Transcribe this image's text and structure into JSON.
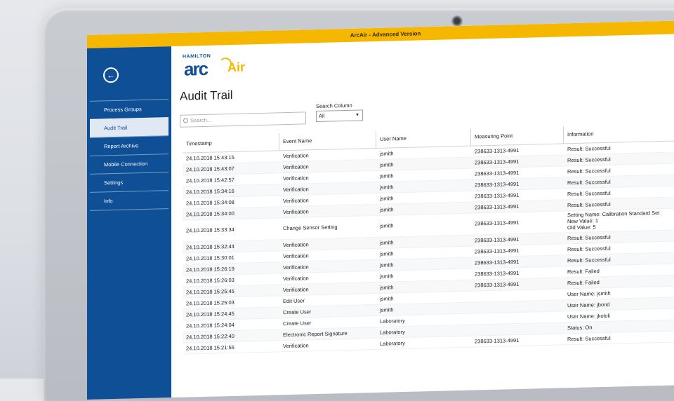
{
  "window": {
    "title": "ArcAir - Advanced Version"
  },
  "sidebar": {
    "back_icon": "arrow-left-circle-icon",
    "items": [
      {
        "label": "Process Groups",
        "active": false
      },
      {
        "label": "Audit Trail",
        "active": true
      },
      {
        "label": "Report Archive",
        "active": false
      },
      {
        "label": "Mobile Connection",
        "active": false
      },
      {
        "label": "Settings",
        "active": false
      },
      {
        "label": "Info",
        "active": false
      }
    ]
  },
  "logo": {
    "brand": "HAMILTON",
    "arc": "arc",
    "air": "Air"
  },
  "page": {
    "title": "Audit Trail"
  },
  "search": {
    "placeholder": "Search..."
  },
  "search_column": {
    "label": "Search Column",
    "selected": "All"
  },
  "table": {
    "columns": [
      "Timestamp",
      "Event Name",
      "User Name",
      "Measuring Point",
      "Information"
    ],
    "rows": [
      {
        "ts": "24.10.2018 15:43:15",
        "event": "Verification",
        "user": "jsmith",
        "mp": "238633-1313-4991",
        "info": [
          "Result: Successful"
        ]
      },
      {
        "ts": "24.10.2018 15:43:07",
        "event": "Verification",
        "user": "jsmith",
        "mp": "238633-1313-4991",
        "info": [
          "Result: Successful"
        ]
      },
      {
        "ts": "24.10.2018 15:42:57",
        "event": "Verification",
        "user": "jsmith",
        "mp": "238633-1313-4991",
        "info": [
          "Result: Successful"
        ]
      },
      {
        "ts": "24.10.2018 15:34:16",
        "event": "Verification",
        "user": "jsmith",
        "mp": "238633-1313-4991",
        "info": [
          "Result: Successful"
        ]
      },
      {
        "ts": "24.10.2018 15:34:08",
        "event": "Verification",
        "user": "jsmith",
        "mp": "238633-1313-4991",
        "info": [
          "Result: Successful"
        ]
      },
      {
        "ts": "24.10.2018 15:34:00",
        "event": "Verification",
        "user": "jsmith",
        "mp": "238633-1313-4991",
        "info": [
          "Result: Successful"
        ]
      },
      {
        "ts": "24.10.2018 15:33:34",
        "event": "Change Sensor Setting",
        "user": "jsmith",
        "mp": "238633-1313-4991",
        "info": [
          "Setting Name: Calibration Standard Set",
          "New Value: 1",
          "Old Value: 5"
        ]
      },
      {
        "ts": "24.10.2018 15:32:44",
        "event": "Verification",
        "user": "jsmith",
        "mp": "238633-1313-4991",
        "info": [
          "Result: Successful"
        ]
      },
      {
        "ts": "24.10.2018 15:30:01",
        "event": "Verification",
        "user": "jsmith",
        "mp": "238633-1313-4991",
        "info": [
          "Result: Successful"
        ]
      },
      {
        "ts": "24.10.2018 15:26:19",
        "event": "Verification",
        "user": "jsmith",
        "mp": "238633-1313-4991",
        "info": [
          "Result: Successful"
        ]
      },
      {
        "ts": "24.10.2018 15:26:03",
        "event": "Verification",
        "user": "jsmith",
        "mp": "238633-1313-4991",
        "info": [
          "Result: Failed"
        ]
      },
      {
        "ts": "24.10.2018 15:25:45",
        "event": "Verification",
        "user": "jsmith",
        "mp": "238633-1313-4991",
        "info": [
          "Result: Failed"
        ]
      },
      {
        "ts": "24.10.2018 15:25:03",
        "event": "Edit User",
        "user": "jsmith",
        "mp": "",
        "info": [
          "User Name: jsmith"
        ]
      },
      {
        "ts": "24.10.2018 15:24:45",
        "event": "Create User",
        "user": "jsmith",
        "mp": "",
        "info": [
          "User Name: jbond"
        ]
      },
      {
        "ts": "24.10.2018 15:24:04",
        "event": "Create User",
        "user": "Laboratory",
        "mp": "",
        "info": [
          "User Name: jkololi"
        ]
      },
      {
        "ts": "24.10.2018 15:22:40",
        "event": "Electronic Report Signature",
        "user": "Laboratory",
        "mp": "",
        "info": [
          "Status: On"
        ]
      },
      {
        "ts": "24.10.2018 15:21:56",
        "event": "Verification",
        "user": "Laboratory",
        "mp": "238633-1313-4991",
        "info": [
          "Result: Successful"
        ]
      }
    ]
  },
  "colors": {
    "titlebar": "#f5b700",
    "sidebar": "#0e4f96",
    "accent": "#f5b700"
  }
}
